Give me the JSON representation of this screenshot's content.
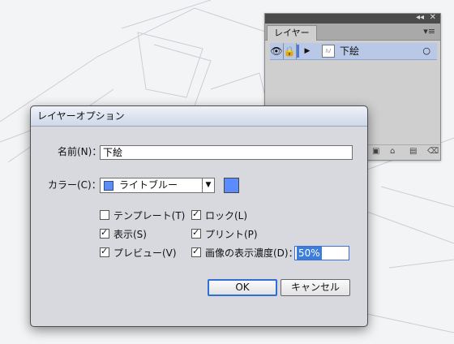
{
  "layers_panel": {
    "tab_label": "レイヤー",
    "collapse_label": "◂◂",
    "close_label": "✕",
    "menu_label": "▾≡",
    "row": {
      "eye_icon": "👁",
      "lock_icon": "🔒",
      "expand_icon": "▶",
      "thumb_icon": "ﾊﾉ",
      "name": "下絵",
      "target_icon": "○"
    },
    "footer_icons": [
      "⟲",
      "▣",
      "⌂",
      "▤",
      "⌫"
    ]
  },
  "dialog": {
    "title": "レイヤーオプション",
    "name_label": "名前(N)：",
    "name_value": "下絵",
    "color_label": "カラー(C)：",
    "color_value": "ライトブルー",
    "color_hex": "#5b8cff",
    "dropdown_arrow": "▼",
    "checkboxes": {
      "template": {
        "label": "テンプレート(T)",
        "checked": false
      },
      "lock": {
        "label": "ロック(L)",
        "checked": true
      },
      "show": {
        "label": "表示(S)",
        "checked": true
      },
      "print": {
        "label": "プリント(P)",
        "checked": true
      },
      "preview": {
        "label": "プレビュー(V)",
        "checked": true
      },
      "dim_images": {
        "label": "画像の表示濃度(D)：",
        "checked": true
      }
    },
    "dim_value": "50%",
    "ok_label": "OK",
    "cancel_label": "キャンセル"
  }
}
